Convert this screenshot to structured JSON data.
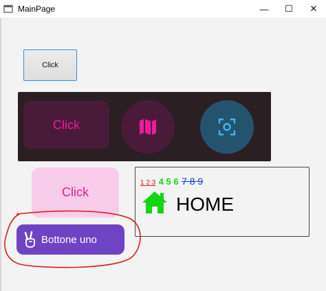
{
  "window": {
    "title": "MainPage",
    "minimize_glyph": "—",
    "maximize_glyph": "☐",
    "close_glyph": "✕"
  },
  "buttons": {
    "standard_click": "Click",
    "dark_click": "Click",
    "pink_click": "Click",
    "purple_label": "Bottone uno"
  },
  "icons": {
    "map": "map-icon",
    "focus": "focus-icon",
    "home": "home-icon",
    "peace": "victory-hand-icon"
  },
  "home_panel": {
    "nums_red": "1 2 3",
    "nums_green": "4 5 6",
    "nums_blue": "7 8 9",
    "label": "HOME"
  },
  "colors": {
    "accent_pink": "#e41c9a",
    "purple": "#6f44c4",
    "home_green": "#13d613",
    "annotation_red": "#e01a1a"
  }
}
